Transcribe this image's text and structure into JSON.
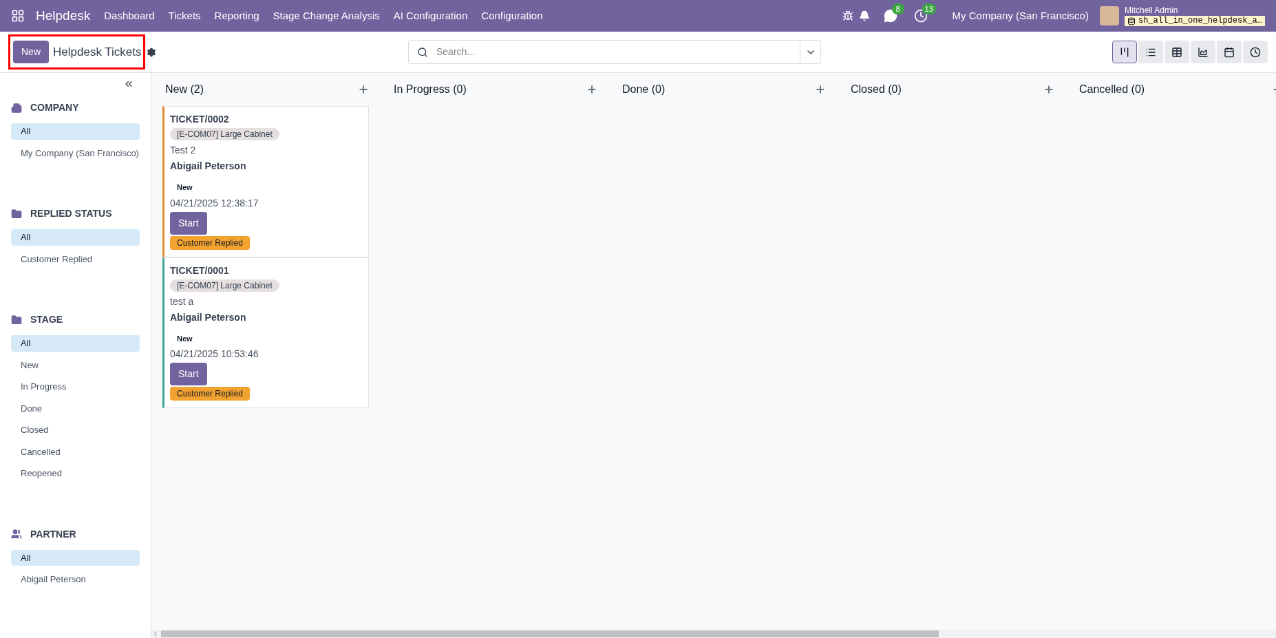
{
  "navbar": {
    "app": "Helpdesk",
    "menu": [
      "Dashboard",
      "Tickets",
      "Reporting",
      "Stage Change Analysis",
      "AI Configuration",
      "Configuration"
    ],
    "messages_count": "8",
    "activities_count": "13",
    "company": "My Company (San Francisco)",
    "user": "Mitchell Admin",
    "database": "sh_all_in_one_helpdesk_a…"
  },
  "control_panel": {
    "new_button": "New",
    "title": "Helpdesk Tickets",
    "search": {
      "placeholder": "Search..."
    },
    "views": [
      {
        "kind": "kanban",
        "selected": true
      },
      {
        "kind": "list",
        "selected": false
      },
      {
        "kind": "pivot",
        "selected": false
      },
      {
        "kind": "graph",
        "selected": false
      },
      {
        "kind": "calendar",
        "selected": false
      },
      {
        "kind": "activity",
        "selected": false
      }
    ]
  },
  "sidebar": {
    "sections": [
      {
        "kind": "company",
        "title": "COMPANY",
        "items": [
          {
            "label": "All",
            "selected": true
          },
          {
            "label": "My Company (San Francisco)",
            "selected": false
          }
        ]
      },
      {
        "kind": "folder",
        "title": "REPLIED STATUS",
        "items": [
          {
            "label": "All",
            "selected": true
          },
          {
            "label": "Customer Replied",
            "selected": false
          }
        ]
      },
      {
        "kind": "folder",
        "title": "STAGE",
        "items": [
          {
            "label": "All",
            "selected": true
          },
          {
            "label": "New",
            "selected": false
          },
          {
            "label": "In Progress",
            "selected": false
          },
          {
            "label": "Done",
            "selected": false
          },
          {
            "label": "Closed",
            "selected": false
          },
          {
            "label": "Cancelled",
            "selected": false
          },
          {
            "label": "Reopened",
            "selected": false
          }
        ]
      },
      {
        "kind": "people",
        "title": "PARTNER",
        "items": [
          {
            "label": "All",
            "selected": true
          },
          {
            "label": "Abigail Peterson",
            "selected": false
          }
        ]
      }
    ]
  },
  "columns": [
    {
      "title": "New (2)",
      "cards": [
        {
          "name": "TICKET/0002",
          "tag": "[E-COM07] Large Cabinet",
          "description": "Test 2",
          "partner": "Abigail Peterson",
          "stage": "New",
          "date": "04/21/2025 12:38:17",
          "button": "Start",
          "badge": "Customer Replied",
          "color": "#e8892b"
        },
        {
          "name": "TICKET/0001",
          "tag": "[E-COM07] Large Cabinet",
          "description": "test a",
          "partner": "Abigail Peterson",
          "stage": "New",
          "date": "04/21/2025 10:53:46",
          "button": "Start",
          "badge": "Customer Replied",
          "color": "#3fa59a"
        }
      ]
    },
    {
      "title": "In Progress (0)"
    },
    {
      "title": "Done (0)"
    },
    {
      "title": "Closed (0)"
    },
    {
      "title": "Cancelled (0)"
    }
  ]
}
